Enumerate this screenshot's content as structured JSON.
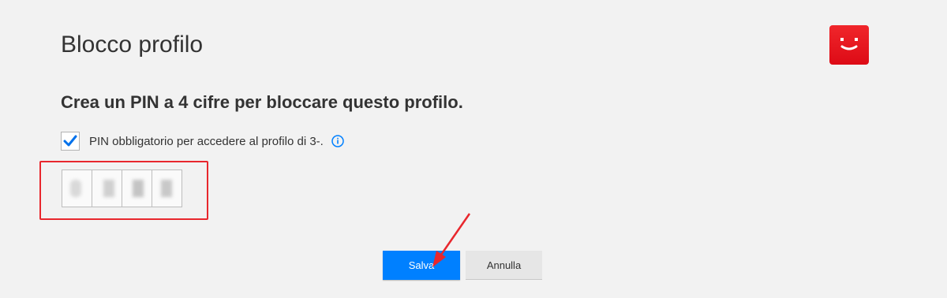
{
  "header": {
    "title": "Blocco profilo",
    "avatar_icon": "smiley-icon",
    "avatar_color": "#e50914"
  },
  "main": {
    "subtitle": "Crea un PIN a 4 cifre per bloccare questo profilo.",
    "require_pin": {
      "checked": true,
      "label": "PIN obbligatorio per accedere al profilo di 3-.",
      "info_icon": "info-icon"
    },
    "pin_digits": [
      "",
      "",
      "",
      ""
    ]
  },
  "actions": {
    "save_label": "Salva",
    "cancel_label": "Annulla",
    "save_color": "#0080ff"
  },
  "annotations": {
    "highlight_color": "#e8272d"
  }
}
